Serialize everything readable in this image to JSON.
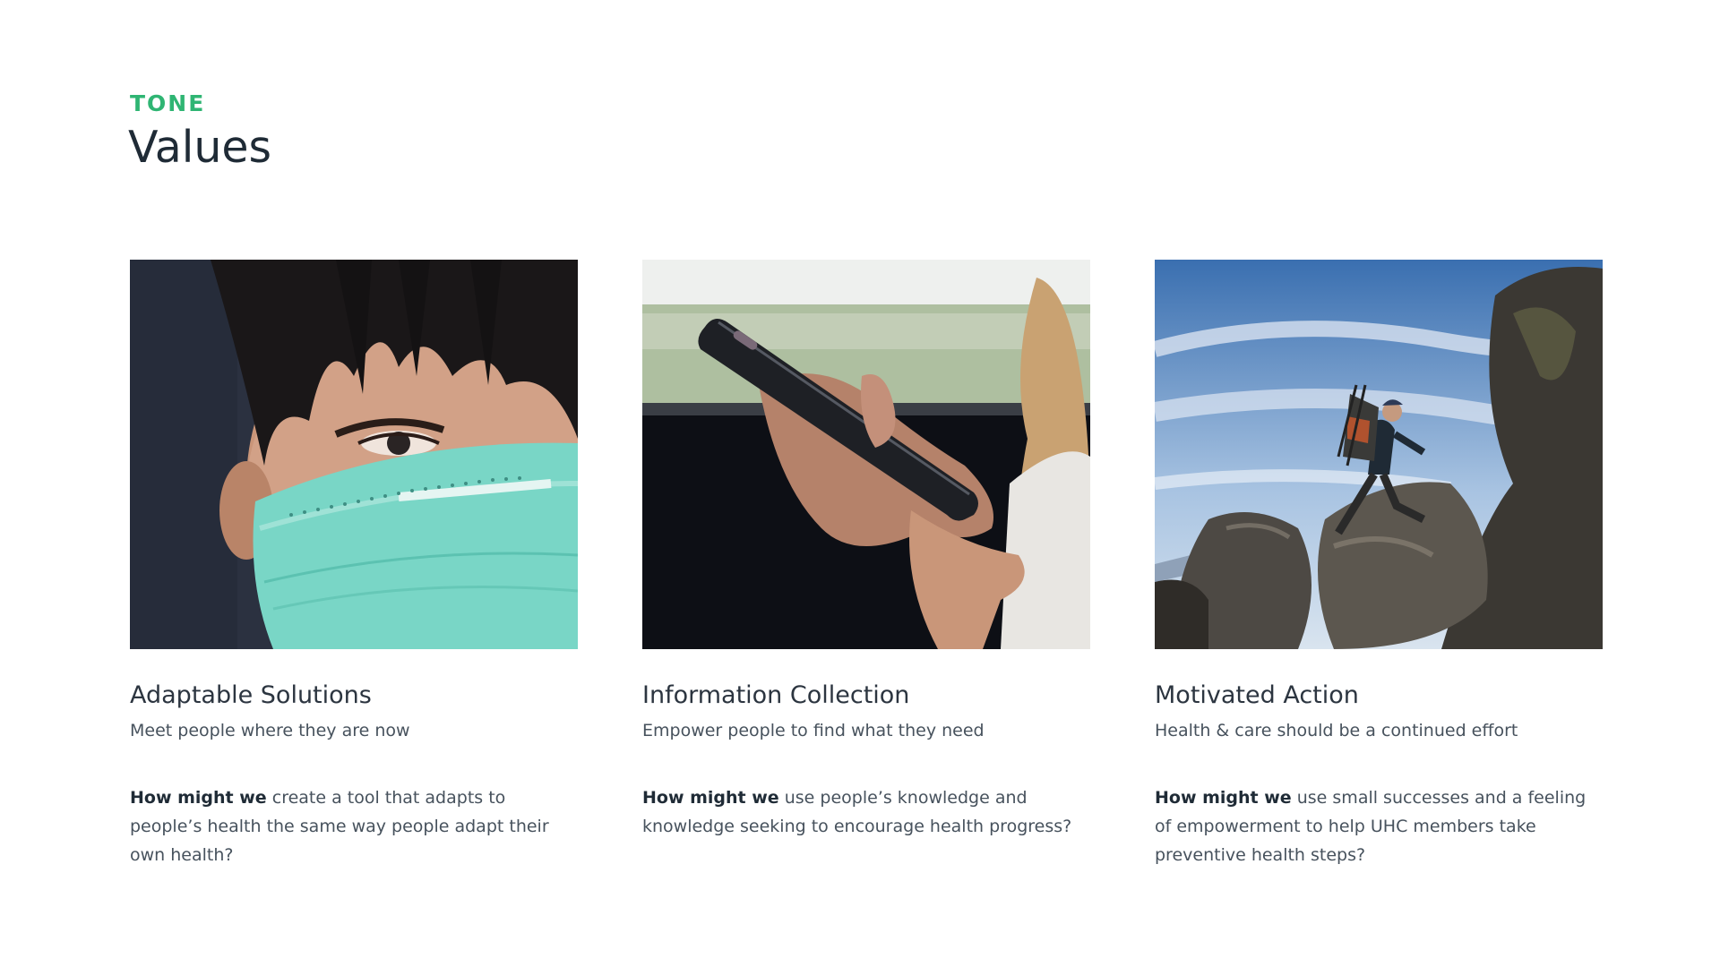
{
  "header": {
    "eyebrow": "TONE",
    "title": "Values"
  },
  "cards": [
    {
      "title": "Adaptable Solutions",
      "subtitle": "Meet people where they are now",
      "lead": "How might we",
      "body": " create a tool that adapts to people’s health the same way people adapt their own health?",
      "image_icon": "masked-person-photo"
    },
    {
      "title": "Information Collection",
      "subtitle": "Empower people to find what they need",
      "lead": "How might we",
      "body": " use people’s knowledge and knowledge seeking to encourage health progress?",
      "image_icon": "phone-in-hand-photo"
    },
    {
      "title": "Motivated Action",
      "subtitle": "Health & care should be a continued effort",
      "lead": "How might we",
      "body": " use small successes and a feeling of empowerment to help UHC members take preventive health steps?",
      "image_icon": "hiker-on-rocks-photo"
    }
  ],
  "colors": {
    "accent": "#2fb573",
    "heading": "#1f2b36",
    "text": "#47525d"
  }
}
